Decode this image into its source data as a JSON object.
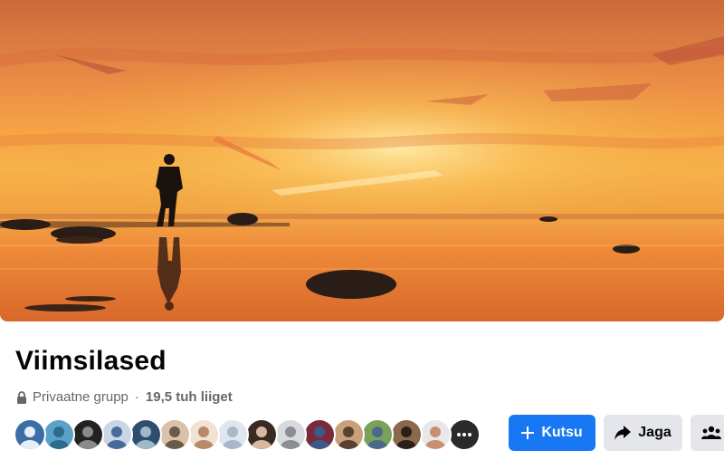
{
  "group": {
    "name": "Viimsilased",
    "privacy_label": "Privaatne grupp",
    "separator": "·",
    "members_label": "19,5 tuh liiget"
  },
  "actions": {
    "invite_label": "Kutsu",
    "share_label": "Jaga"
  },
  "members": {
    "avatars": [
      {
        "name": "member-avatar",
        "colors": [
          "#3b6ea5",
          "#e8eef6"
        ]
      },
      {
        "name": "member-avatar",
        "colors": [
          "#5aa0c8",
          "#2b6c8a"
        ]
      },
      {
        "name": "member-avatar",
        "colors": [
          "#222222",
          "#8a8a8a"
        ]
      },
      {
        "name": "member-avatar",
        "colors": [
          "#c8d6e6",
          "#4a6b9a"
        ]
      },
      {
        "name": "member-avatar",
        "colors": [
          "#2e4e6e",
          "#9fb8cc"
        ]
      },
      {
        "name": "member-avatar",
        "colors": [
          "#d9c2a9",
          "#6a5a4a"
        ]
      },
      {
        "name": "member-avatar",
        "colors": [
          "#f2e2d2",
          "#b88a6a"
        ]
      },
      {
        "name": "member-avatar",
        "colors": [
          "#dfe6ee",
          "#a9b8c8"
        ]
      },
      {
        "name": "member-avatar",
        "colors": [
          "#3a2a22",
          "#d8b8a0"
        ]
      },
      {
        "name": "member-avatar",
        "colors": [
          "#d8dadf",
          "#8a8d91"
        ]
      },
      {
        "name": "member-avatar",
        "colors": [
          "#7a2a3a",
          "#3a5a8a"
        ]
      },
      {
        "name": "member-avatar",
        "colors": [
          "#c8a07a",
          "#5a4030"
        ]
      },
      {
        "name": "member-avatar",
        "colors": [
          "#7aa05a",
          "#4a6a8a"
        ]
      },
      {
        "name": "member-avatar",
        "colors": [
          "#8a6a4a",
          "#2a2018"
        ]
      },
      {
        "name": "member-avatar",
        "colors": [
          "#e8e8e8",
          "#c89070"
        ]
      },
      {
        "name": "more-members",
        "colors": [
          "#2a2a2a",
          "#555555"
        ]
      }
    ]
  },
  "colors": {
    "accent": "#1877f2",
    "secondary_button": "#e4e6eb",
    "muted_text": "#65676b"
  }
}
